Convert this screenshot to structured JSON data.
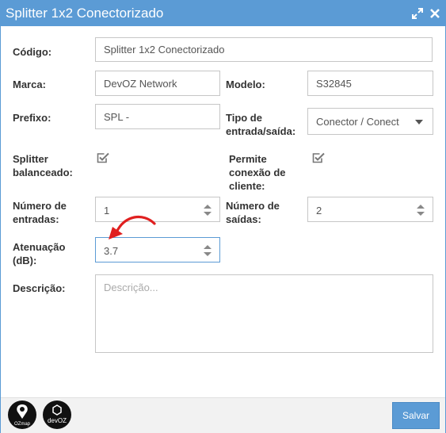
{
  "window": {
    "title": "Splitter 1x2 Conectorizado"
  },
  "icons": {
    "expand": "expand-icon",
    "close": "close-icon",
    "checkbox": "checkmark-icon",
    "spinner": "spinner-arrows-icon",
    "annotation": "red-curved-arrow"
  },
  "colors": {
    "accent": "#5b9bd5",
    "annotation": "#e02020",
    "text": "#333333"
  },
  "form": {
    "codigo": {
      "label": "Código:",
      "value": "Splitter 1x2 Conectorizado"
    },
    "marca": {
      "label": "Marca:",
      "value": "DevOZ Network"
    },
    "modelo": {
      "label": "Modelo:",
      "value": "S32845"
    },
    "prefixo": {
      "label": "Prefixo:",
      "value": "SPL -"
    },
    "tipo": {
      "label_line1": "Tipo de",
      "label_line2": "entrada/saída:",
      "value": "Conector / Conector"
    },
    "balanceado": {
      "label_line1": "Splitter",
      "label_line2": "balanceado:",
      "checked": true
    },
    "conexao": {
      "label_line1": "Permite",
      "label_line2": "conexão de",
      "label_line3": "cliente:",
      "checked": true
    },
    "entradas": {
      "label_line1": "Número de",
      "label_line2": "entradas:",
      "value": "1"
    },
    "saidas": {
      "label_line1": "Número de",
      "label_line2": "saídas:",
      "value": "2"
    },
    "atenuacao": {
      "label_line1": "Atenuação",
      "label_line2": "(dB):",
      "value": "3.7"
    },
    "descricao": {
      "label": "Descrição:",
      "placeholder": "Descrição..."
    }
  },
  "footer": {
    "logo1": "OZmap",
    "logo2": "devOZ",
    "save_label": "Salvar"
  }
}
